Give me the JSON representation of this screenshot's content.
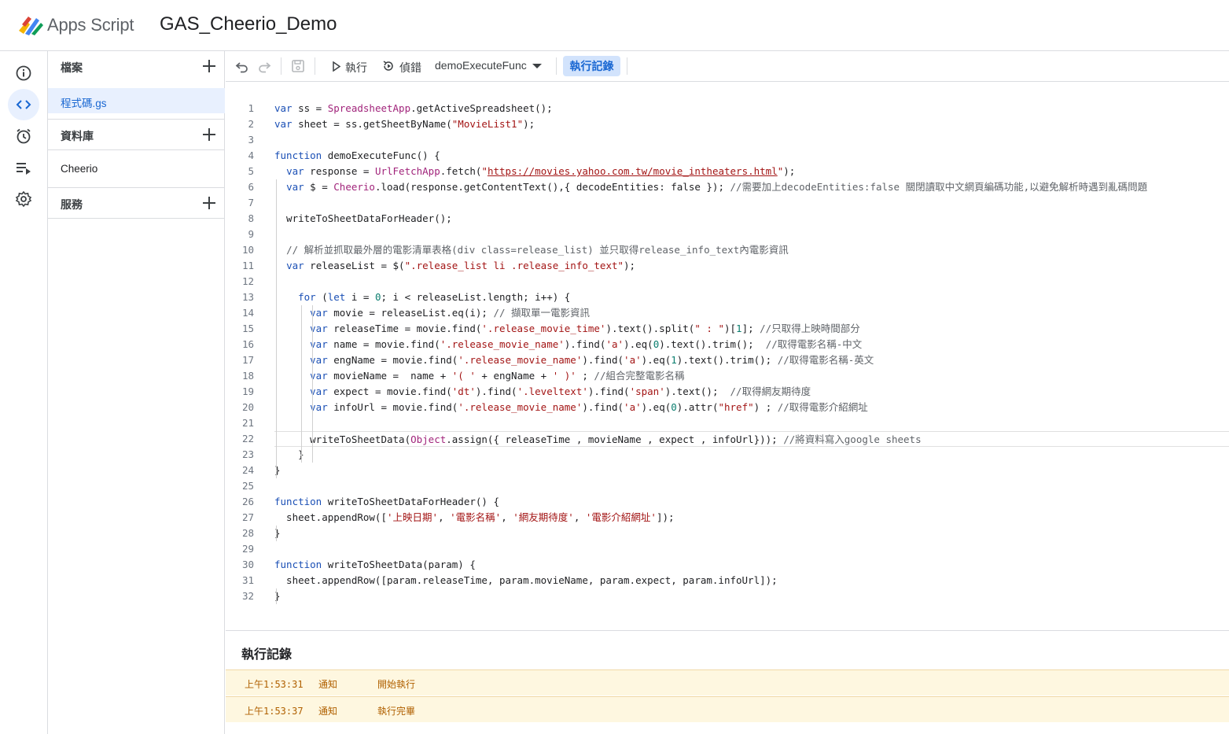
{
  "header": {
    "brand": "Apps Script",
    "project_title": "GAS_Cheerio_Demo"
  },
  "rail": {
    "items": [
      "overview-icon",
      "editor-icon",
      "triggers-icon",
      "executions-icon",
      "settings-icon"
    ],
    "active": "editor-icon"
  },
  "files_panel": {
    "files_label": "檔案",
    "files": [
      "程式碼.gs"
    ],
    "libraries_label": "資料庫",
    "libraries": [
      "Cheerio"
    ],
    "services_label": "服務"
  },
  "toolbar": {
    "run_label": "執行",
    "debug_label": "偵錯",
    "function_selected": "demoExecuteFunc",
    "log_button_label": "執行記錄"
  },
  "editor": {
    "line_numbers": [
      "1",
      "2",
      "3",
      "4",
      "5",
      "6",
      "7",
      "8",
      "9",
      "10",
      "11",
      "12",
      "13",
      "14",
      "15",
      "16",
      "17",
      "18",
      "19",
      "20",
      "21",
      "22",
      "23",
      "24",
      "25",
      "26",
      "27",
      "28",
      "29",
      "30",
      "31",
      "32"
    ],
    "lines": [
      "var ss = SpreadsheetApp.getActiveSpreadsheet();",
      "var sheet = ss.getSheetByName(\"MovieList1\");",
      "",
      "function demoExecuteFunc() {",
      "  var response = UrlFetchApp.fetch(\"https://movies.yahoo.com.tw/movie_intheaters.html\");",
      "  var $ = Cheerio.load(response.getContentText(),{ decodeEntities: false }); //需要加上decodeEntities:false 關閉讀取中文網頁編碼功能,以避免解析時遇到亂碼問題",
      "",
      "  writeToSheetDataForHeader();",
      "",
      "  // 解析並抓取最外層的電影清單表格(div class=release_list) 並只取得release_info_text內電影資訊",
      "  var releaseList = $(\".release_list li .release_info_text\");",
      "",
      "    for (let i = 0; i < releaseList.length; i++) {",
      "      var movie = releaseList.eq(i); // 擷取單一電影資訊",
      "      var releaseTime = movie.find('.release_movie_time').text().split(\" : \")[1]; //只取得上映時間部分",
      "      var name = movie.find('.release_movie_name').find('a').eq(0).text().trim();  //取得電影名稱-中文",
      "      var engName = movie.find('.release_movie_name').find('a').eq(1).text().trim(); //取得電影名稱-英文",
      "      var movieName =  name + '( ' + engName + ' )' ; //組合完整電影名稱",
      "      var expect = movie.find('dt').find('.leveltext').find('span').text();  //取得網友期待度",
      "      var infoUrl = movie.find('.release_movie_name').find('a').eq(0).attr(\"href\") ; //取得電影介紹網址",
      "",
      "      writeToSheetData(Object.assign({ releaseTime , movieName , expect , infoUrl})); //將資料寫入google sheets",
      "    }",
      "}",
      "",
      "function writeToSheetDataForHeader() {",
      "  sheet.appendRow(['上映日期', '電影名稱', '網友期待度', '電影介紹網址']);",
      "}",
      "",
      "function writeToSheetData(param) {",
      "  sheet.appendRow([param.releaseTime, param.movieName, param.expect, param.infoUrl]);",
      "}"
    ]
  },
  "log": {
    "title": "執行記錄",
    "entries": [
      {
        "time": "上午1:53:31",
        "level": "通知",
        "message": "開始執行"
      },
      {
        "time": "上午1:53:37",
        "level": "通知",
        "message": "執行完畢"
      }
    ]
  },
  "colors": {
    "accent": "#1967d2",
    "active_bg": "#e8f0fe",
    "log_bg": "#fef7e0",
    "log_text": "#b06000"
  }
}
